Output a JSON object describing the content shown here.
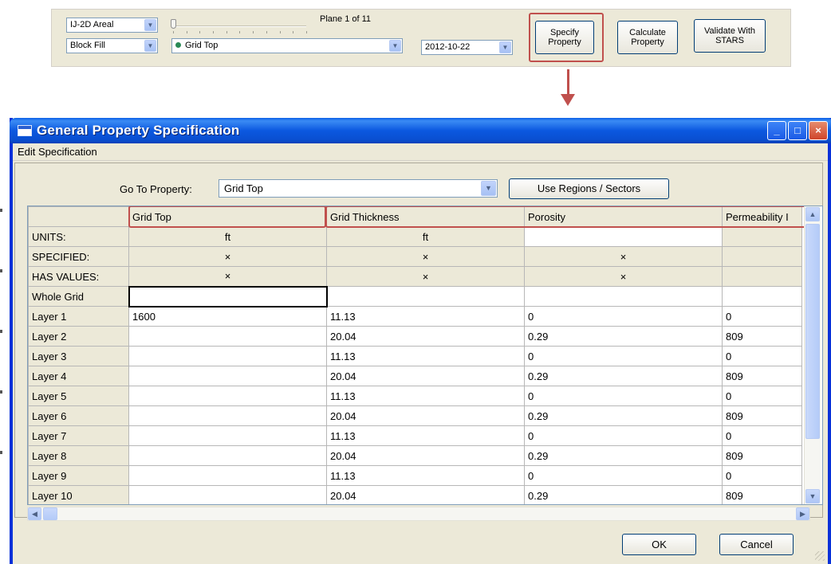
{
  "toolbar": {
    "view_mode": "IJ-2D Areal",
    "fill_mode": "Block Fill",
    "property": "Grid Top",
    "plane_label": "Plane 1 of 11",
    "date": "2012-10-22",
    "specify_btn": [
      "Specify",
      "Property"
    ],
    "calculate_btn": [
      "Calculate",
      "Property"
    ],
    "validate_btn": [
      "Validate With",
      "STARS"
    ]
  },
  "dialog": {
    "title": "General Property Specification",
    "menu": "Edit Specification",
    "goto_label": "Go To Property:",
    "goto_value": "Grid Top",
    "regions_btn": "Use Regions / Sectors",
    "ok": "OK",
    "cancel": "Cancel"
  },
  "grid": {
    "columns": [
      "Grid Top",
      "Grid Thickness",
      "Porosity",
      "Permeability I"
    ],
    "meta_rows": [
      {
        "label": "UNITS:",
        "cells": [
          "ft",
          "ft",
          "",
          ""
        ]
      },
      {
        "label": "SPECIFIED:",
        "cells": [
          "×",
          "×",
          "×",
          ""
        ]
      },
      {
        "label": "HAS VALUES:",
        "cells": [
          "×",
          "×",
          "×",
          ""
        ]
      }
    ],
    "rows": [
      {
        "label": "Whole Grid",
        "cells": [
          "",
          "",
          "",
          ""
        ]
      },
      {
        "label": "Layer 1",
        "cells": [
          "1600",
          "11.13",
          "0",
          "0"
        ]
      },
      {
        "label": "Layer 2",
        "cells": [
          "",
          "20.04",
          "0.29",
          "809"
        ]
      },
      {
        "label": "Layer 3",
        "cells": [
          "",
          "11.13",
          "0",
          "0"
        ]
      },
      {
        "label": "Layer 4",
        "cells": [
          "",
          "20.04",
          "0.29",
          "809"
        ]
      },
      {
        "label": "Layer 5",
        "cells": [
          "",
          "11.13",
          "0",
          "0"
        ]
      },
      {
        "label": "Layer 6",
        "cells": [
          "",
          "20.04",
          "0.29",
          "809"
        ]
      },
      {
        "label": "Layer 7",
        "cells": [
          "",
          "11.13",
          "0",
          "0"
        ]
      },
      {
        "label": "Layer 8",
        "cells": [
          "",
          "20.04",
          "0.29",
          "809"
        ]
      },
      {
        "label": "Layer 9",
        "cells": [
          "",
          "11.13",
          "0",
          "0"
        ]
      },
      {
        "label": "Layer 10",
        "cells": [
          "",
          "20.04",
          "0.29",
          "809"
        ]
      }
    ]
  },
  "colors": {
    "highlight": "#c0504d",
    "titlebar": "#0a4fd1"
  }
}
